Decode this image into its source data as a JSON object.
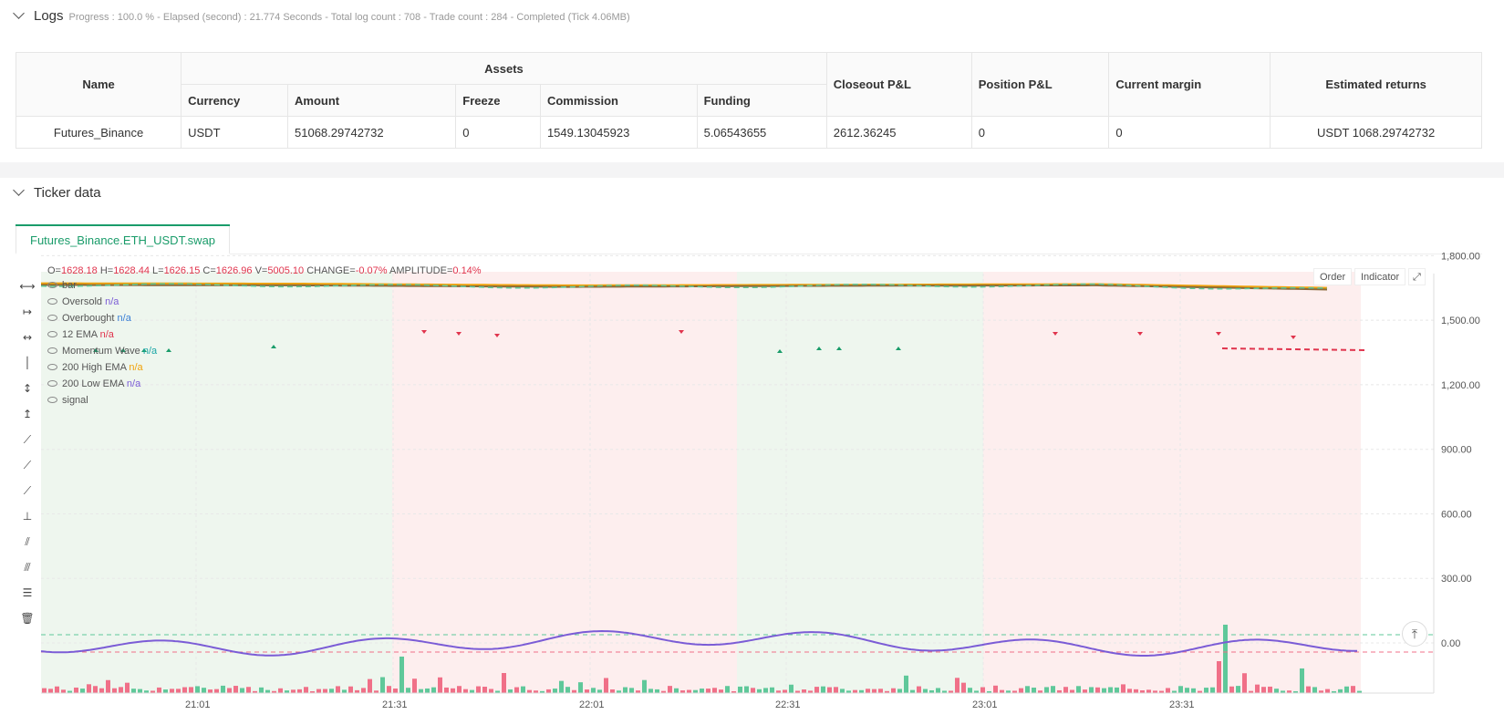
{
  "logs": {
    "title": "Logs",
    "progress_text": "Progress : 100.0 % - Elapsed (second) : 21.774  Seconds - Total log count : 708 - Trade count : 284 - Completed (Tick 4.06MB)"
  },
  "assets_table": {
    "col_name": "Name",
    "group_assets": "Assets",
    "col_currency": "Currency",
    "col_amount": "Amount",
    "col_freeze": "Freeze",
    "col_commission": "Commission",
    "col_funding": "Funding",
    "col_closeout": "Closeout P&L",
    "col_position": "Position P&L",
    "col_margin": "Current margin",
    "col_returns": "Estimated returns",
    "row": {
      "name": "Futures_Binance",
      "currency": "USDT",
      "amount": "51068.29742732",
      "freeze": "0",
      "commission": "1549.13045923",
      "funding": "5.06543655",
      "closeout": "2612.36245",
      "position": "0",
      "margin": "0",
      "returns": "USDT 1068.29742732"
    }
  },
  "ticker": {
    "title": "Ticker data",
    "tab_label": "Futures_Binance.ETH_USDT.swap",
    "order_button": "Order",
    "indicator_button": "Indicator",
    "ohlc": {
      "o_label": "O=",
      "o": "1628.18",
      "h_label": "H=",
      "h": "1628.44",
      "l_label": "L=",
      "l": "1626.15",
      "c_label": "C=",
      "c": "1626.96",
      "v_label": "V=",
      "v": "5005.10",
      "change_label": "CHANGE=",
      "change": "-0.07%",
      "amp_label": "AMPLITUDE=",
      "amp": "0.14%"
    },
    "legend": [
      {
        "name": "bar",
        "value": ""
      },
      {
        "name": "Oversold",
        "value": "n/a",
        "color": "#7b5cd6"
      },
      {
        "name": "Overbought",
        "value": "n/a",
        "color": "#3a7fd6"
      },
      {
        "name": "12 EMA",
        "value": "n/a",
        "color": "#e0344d"
      },
      {
        "name": "Momentum Wave",
        "value": "n/a",
        "color": "#1aa6a6"
      },
      {
        "name": "200 High EMA",
        "value": "n/a",
        "color": "#f0a20a"
      },
      {
        "name": "200 Low EMA",
        "value": "n/a",
        "color": "#7b5cd6"
      },
      {
        "name": "signal",
        "value": ""
      }
    ],
    "y_axis_labels": [
      "1,800.00",
      "1,500.00",
      "1,200.00",
      "900.00",
      "600.00",
      "300.00",
      "0.00"
    ],
    "x_axis_labels": [
      "21:01",
      "21:31",
      "22:01",
      "22:31",
      "23:01",
      "23:31"
    ]
  },
  "chart_data": {
    "type": "line",
    "x": [
      "21:01",
      "21:31",
      "22:01",
      "22:31",
      "23:01",
      "23:31"
    ],
    "ylim": [
      0,
      1950
    ],
    "series": [
      {
        "name": "200 High EMA",
        "color": "#f0a20a",
        "values": [
          1672,
          1670,
          1662,
          1665,
          1668,
          1648
        ]
      },
      {
        "name": "200 Low EMA",
        "color": "#7b5cd6",
        "values": [
          1664,
          1662,
          1655,
          1660,
          1662,
          1640
        ]
      },
      {
        "name": "Momentum Wave",
        "color": "#7b5cd6",
        "values": [
          40,
          -30,
          20,
          50,
          -40,
          -50
        ]
      }
    ],
    "colors": {
      "bull_bg": "#eef6ee",
      "bear_bg": "#fdeeee",
      "up": "#5fc89a",
      "down": "#f07088"
    }
  }
}
